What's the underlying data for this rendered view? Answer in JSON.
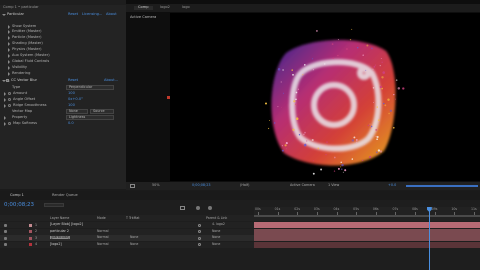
{
  "colors": {
    "accent_blue": "#4a8fe0",
    "playhead": "#4a8fe0",
    "layer_bar_pink": "#b66a74",
    "layer_bar_rose": "#7a4a50",
    "layer_bar_dark": "#5a3438"
  },
  "effects_panel": {
    "title": "Comp 1 • particular",
    "effect_name": "Particular",
    "reset": "Reset",
    "licensing": "Licensing...",
    "about": "About",
    "groups": [
      "Show System",
      "Emitter (Master)",
      "Particle (Master)",
      "Shading (Master)",
      "Physics (Master)",
      "Aux System (Master)",
      "Global Fluid Controls",
      "Visibility",
      "Rendering"
    ],
    "effect2_name": "CC Vector Blur",
    "effect2_reset": "Reset",
    "effect2_about": "About...",
    "type_label": "Type",
    "type_value": "Perpendicular",
    "properties": [
      {
        "name": "Amount",
        "value": "100"
      },
      {
        "name": "Angle Offset",
        "value": "0x+0.0°"
      },
      {
        "name": "Ridge Smoothness",
        "value": "100"
      }
    ],
    "vector_map_label": "Vector Map",
    "vector_map_value": "None",
    "vector_map_source": "Source",
    "property_label": "Property",
    "property_value": "Lightness",
    "map_softness_label": "Map Softness",
    "map_softness_value": "0.0"
  },
  "composition": {
    "tabs": [
      "Comp",
      "logo2",
      "logo"
    ],
    "view_label": "Active Camera",
    "toolbar": {
      "zoom": "50%",
      "timecode": "0;00;08;23",
      "resolution": "(Half)",
      "camera": "Active Camera",
      "views": "1 View",
      "exposure": "+0.0"
    }
  },
  "timeline": {
    "tab": "Comp 1",
    "render_queue": "Render Queue",
    "current_time": "0;00;08;23",
    "columns": {
      "layer_name": "Layer Name",
      "mode": "Mode",
      "trkmat": "T TrkMat",
      "parent": "Parent & Link"
    },
    "ruler": [
      "00s",
      "01s",
      "02s",
      "03s",
      "04s",
      "05s",
      "06s",
      "07s",
      "08s",
      "09s",
      "10s",
      "11s"
    ],
    "playhead_seconds": 8.7,
    "duration_seconds": 12,
    "layers": [
      {
        "num": "1",
        "name": "[Layer Blob] [logo2]",
        "mode": "",
        "trkmat": "",
        "parent": "4. logo2",
        "label_color": "#c38a90"
      },
      {
        "num": "2",
        "name": "particular 2",
        "mode": "Normal",
        "trkmat": "",
        "parent": "None",
        "label_color": "#a35560"
      },
      {
        "num": "3",
        "name": "[particular]",
        "mode": "Normal",
        "trkmat": "None",
        "parent": "None",
        "label_color": "#a35560"
      },
      {
        "num": "4",
        "name": "[logo2]",
        "mode": "Normal",
        "trkmat": "None",
        "parent": "None",
        "label_color": "#b4323c"
      }
    ]
  }
}
